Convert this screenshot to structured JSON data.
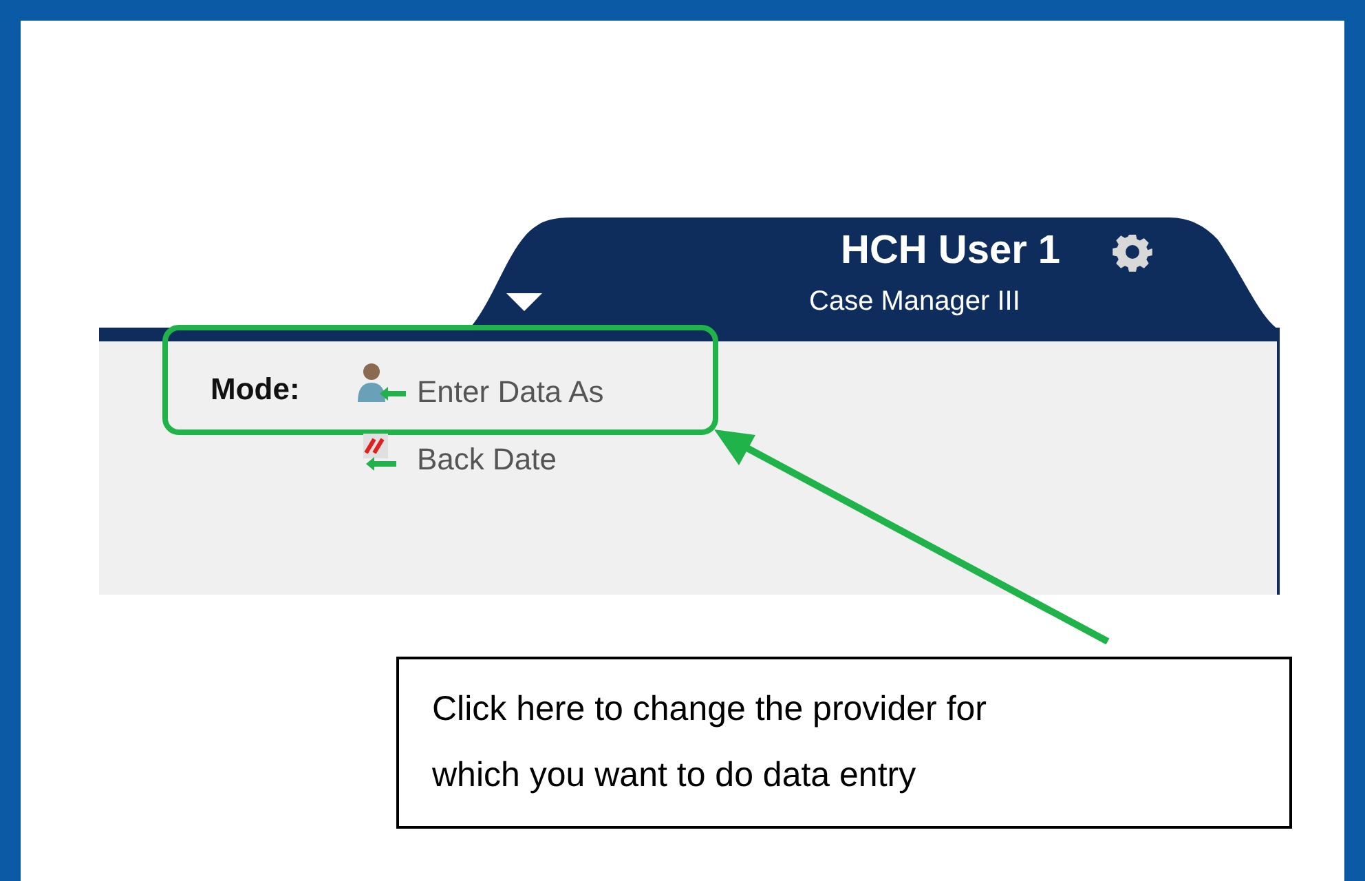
{
  "header": {
    "user_name": "HCH User 1",
    "role": "Case Manager III"
  },
  "mode": {
    "label": "Mode:",
    "options": [
      {
        "label": "Enter Data As",
        "kind": "person",
        "highlighted": true
      },
      {
        "label": "Back Date",
        "kind": "calendar",
        "highlighted": false
      }
    ]
  },
  "callout": {
    "text": "Click here to change the provider for which you want to do data entry"
  }
}
